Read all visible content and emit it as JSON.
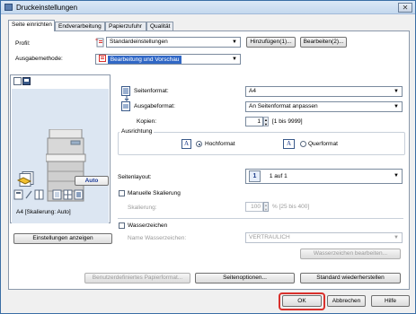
{
  "window": {
    "title": "Druckeinstellungen",
    "close_glyph": "✕"
  },
  "tabs": [
    {
      "label": "Seite einrichten",
      "active": true
    },
    {
      "label": "Endverarbeitung",
      "active": false
    },
    {
      "label": "Papierzufuhr",
      "active": false
    },
    {
      "label": "Qualität",
      "active": false
    }
  ],
  "profile": {
    "label": "Profil:",
    "value": "Standardeinstellungen",
    "add_button": "Hinzufügen(1)...",
    "edit_button": "Bearbeiten(2)..."
  },
  "output_method": {
    "label": "Ausgabemethode:",
    "value": "Bearbeitung und Vorschau"
  },
  "preview": {
    "auto_button": "Auto",
    "caption": "A4 [Skalierung: Auto]",
    "show_settings_button": "Einstellungen anzeigen"
  },
  "page_format": {
    "label": "Seitenformat:",
    "value": "A4"
  },
  "output_format": {
    "label": "Ausgabeformat:",
    "value": "An Seitenformat anpassen"
  },
  "copies": {
    "label": "Kopien:",
    "value": "1",
    "range": "[1 bis 9999]"
  },
  "orientation": {
    "title": "Ausrichtung",
    "portrait_label": "Hochformat",
    "landscape_label": "Querformat",
    "selected": "portrait",
    "portrait_glyph": "A",
    "landscape_glyph": "A"
  },
  "page_layout": {
    "label": "Seitenlayout:",
    "badge": "1",
    "value": "1 auf 1"
  },
  "manual_scaling": {
    "checkbox_label": "Manuelle Skalierung",
    "checked": false,
    "scaling_label": "Skalierung:",
    "value": "100",
    "range": "% [25 bis 400]"
  },
  "watermark": {
    "checkbox_label": "Wasserzeichen",
    "checked": false,
    "name_label": "Name Wasserzeichen:",
    "value": "VERTRAULICH",
    "edit_button": "Wasserzeichen bearbeiten..."
  },
  "bottom_buttons": {
    "custom_paper": "Benutzerdefiniertes Papierformat...",
    "page_options": "Seitenoptionen...",
    "restore_defaults": "Standard wiederherstellen"
  },
  "dialog_buttons": {
    "ok": "OK",
    "cancel": "Abbrechen",
    "help": "Hilfe"
  },
  "colors": {
    "accent": "#3168c6",
    "highlight_ring": "#d9302c",
    "preview_bg": "#dce6f2"
  }
}
